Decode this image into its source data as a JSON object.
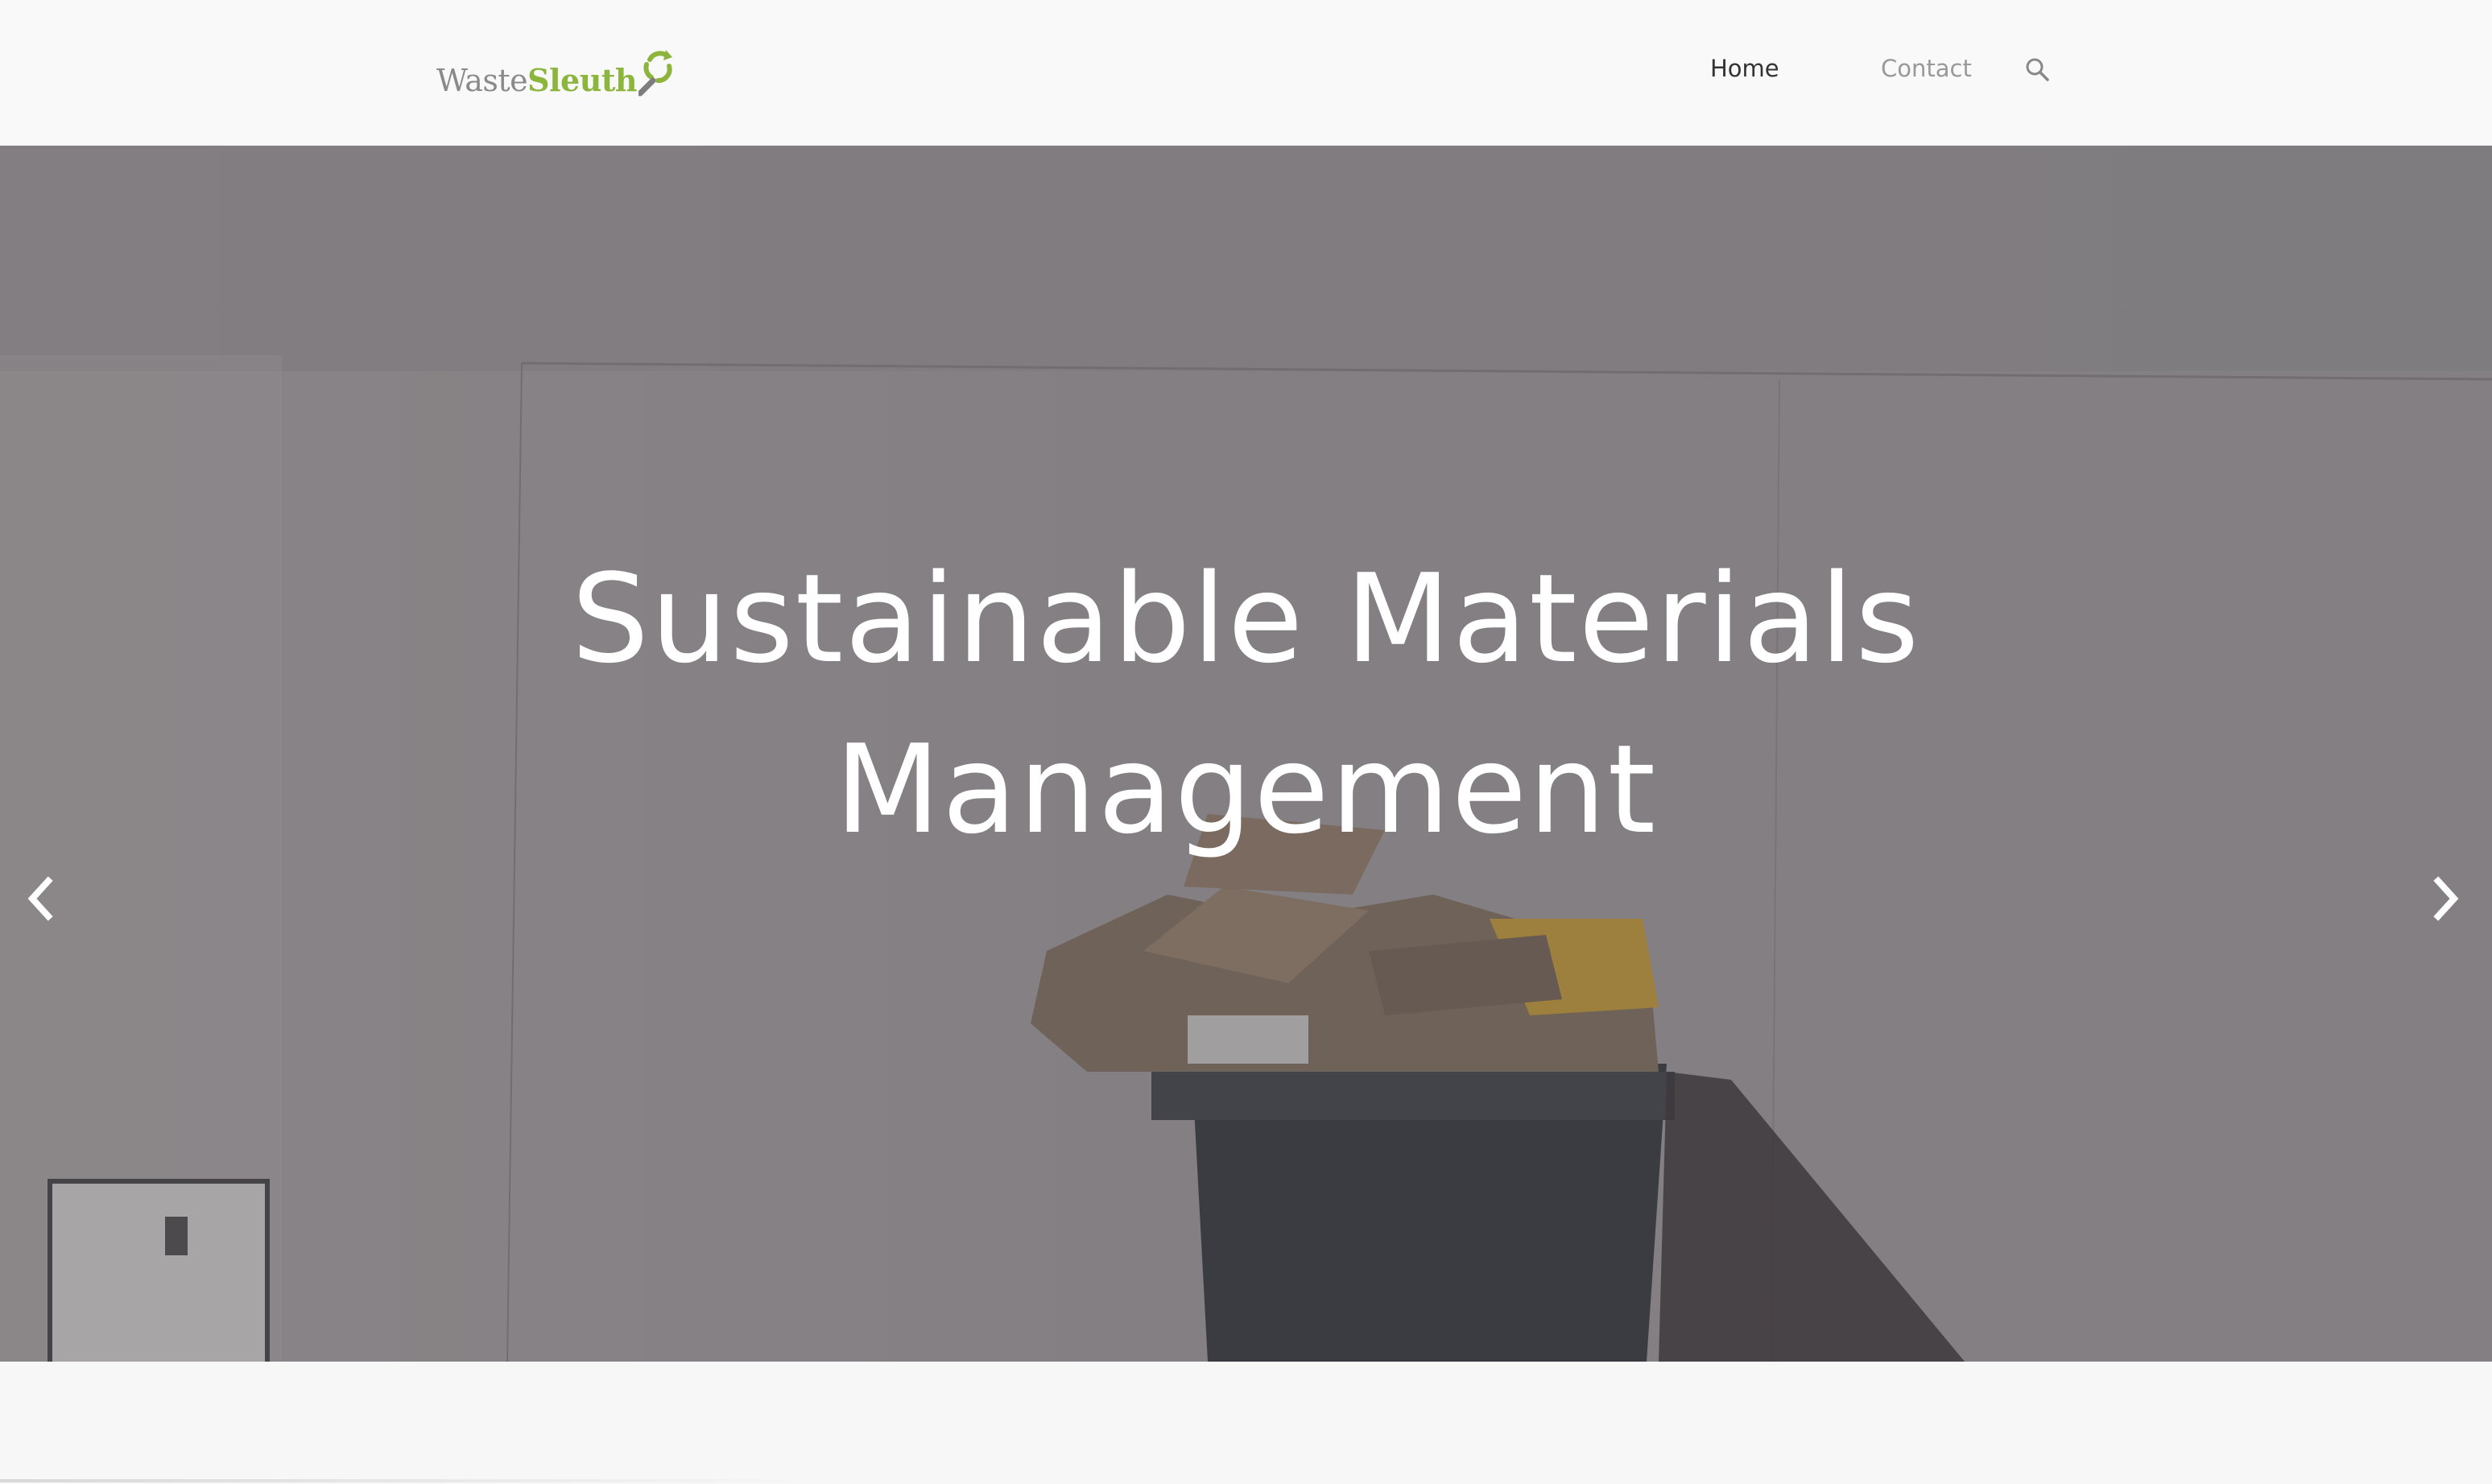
{
  "header": {
    "logo": {
      "part1": "Waste",
      "part2": "Sleuth",
      "icon": "recycle-magnifier-icon"
    },
    "nav": {
      "home": "Home",
      "contact": "Contact",
      "search_icon": "search-icon"
    }
  },
  "hero": {
    "title_line1": "Sustainable Materials",
    "title_line2": "Management",
    "prev_icon": "chevron-left-icon",
    "next_icon": "chevron-right-icon",
    "slides_total": 3,
    "active_slide": 1
  },
  "colors": {
    "brand_green": "#8bb53c",
    "logo_gray": "#8a8a8a",
    "nav_active": "#333333",
    "nav_inactive": "#999999"
  }
}
